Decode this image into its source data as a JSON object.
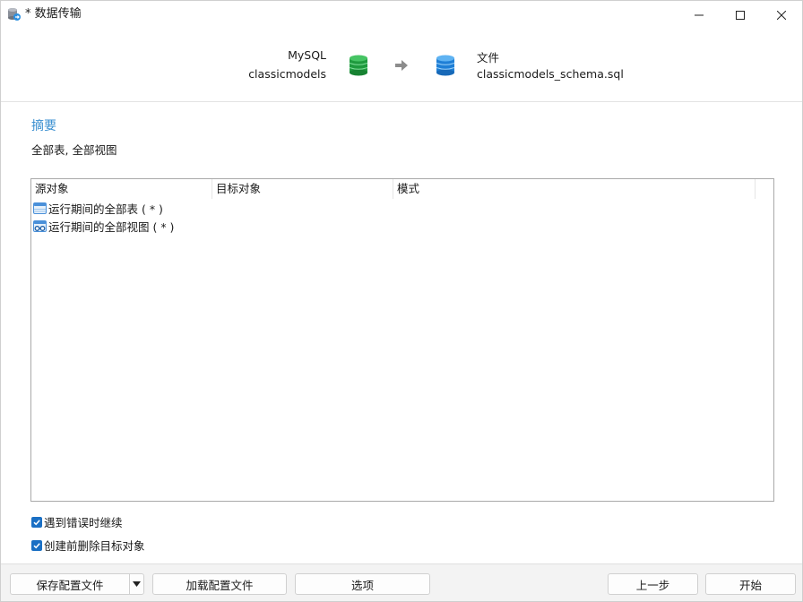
{
  "window": {
    "title": "* 数据传输"
  },
  "transfer": {
    "source_type": "MySQL",
    "source_name": "classicmodels",
    "source_color": "#2bb24c",
    "target_type": "文件",
    "target_name": "classicmodels_schema.sql",
    "target_color": "#2b8fe0"
  },
  "summary": {
    "title": "摘要",
    "text": "全部表, 全部视图",
    "title_color": "#3a8fd0"
  },
  "table": {
    "columns": [
      "源对象",
      "目标对象",
      "模式"
    ],
    "rows": [
      {
        "source": "运行期间的全部表 ( * )",
        "icon": "table-icon"
      },
      {
        "source": "运行期间的全部视图 ( * )",
        "icon": "view-icon"
      }
    ]
  },
  "options": {
    "continue_on_error": {
      "label": "遇到错误时继续",
      "checked": true
    },
    "drop_before_create": {
      "label": "创建前删除目标对象",
      "checked": true
    }
  },
  "buttons": {
    "save_profile": "保存配置文件",
    "load_profile": "加载配置文件",
    "options": "选项",
    "back": "上一步",
    "start": "开始"
  }
}
